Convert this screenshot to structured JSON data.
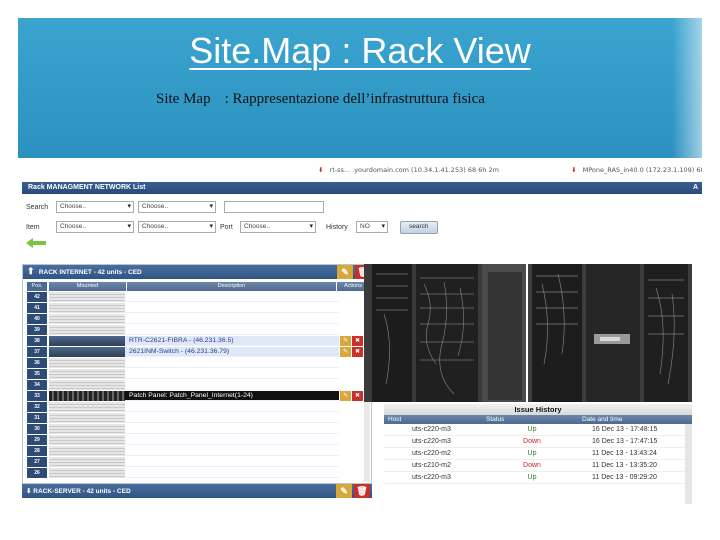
{
  "slide": {
    "title": "Site.Map : Rack View",
    "subtitle_left": "Site Map",
    "subtitle_right": ": Rappresentazione dell’infrastruttura fisica",
    "accent_color": "#3aa4cf"
  },
  "app": {
    "top_links": [
      "rt-ss... .yourdomain.com (10.34.1.41.253) 68 6h 2m",
      "MPone_RAS_in40.0 (172.23.1.109) 68 6h 2m"
    ],
    "list_title": "Rack MANAGMENT NETWORK List",
    "list_title_right": "A",
    "filters": {
      "search_label": "Search",
      "item_label": "Item",
      "port_label": "Port",
      "history_label": "History",
      "choose": "Choose..",
      "history_value": "NO",
      "search_button": "search"
    },
    "rack1": {
      "title": "RACK INTERNET - 42 units - CED",
      "col_pos": "Pos.",
      "col_mounted": "Mounted",
      "col_description": "Description",
      "col_actions": "Actions",
      "rows": [
        {
          "u": "42",
          "desc": ""
        },
        {
          "u": "41",
          "desc": ""
        },
        {
          "u": "40",
          "desc": ""
        },
        {
          "u": "39",
          "desc": ""
        },
        {
          "u": "38",
          "desc": "RTR-C2621-FIBRA - (46.231.36.5)"
        },
        {
          "u": "37",
          "desc": "2621INM-Switch - (46.231.36.79)"
        },
        {
          "u": "36",
          "desc": ""
        },
        {
          "u": "35",
          "desc": ""
        },
        {
          "u": "34",
          "desc": ""
        },
        {
          "u": "33",
          "desc": "Patch Panel: Patch_Panel_Internet(1-24)"
        },
        {
          "u": "32",
          "desc": ""
        },
        {
          "u": "31",
          "desc": ""
        },
        {
          "u": "30",
          "desc": ""
        },
        {
          "u": "29",
          "desc": ""
        },
        {
          "u": "28",
          "desc": ""
        },
        {
          "u": "27",
          "desc": ""
        },
        {
          "u": "26",
          "desc": ""
        }
      ]
    },
    "rack2": {
      "title": "RACK-SERVER - 42 units - CED"
    },
    "issue_history": {
      "title": "Issue History",
      "col_host": "Host",
      "col_status": "Status",
      "col_date": "Date and time",
      "rows": [
        {
          "host": "uts-c220-m3",
          "status": "Up",
          "date": "16 Dec 13 - 17:48:15"
        },
        {
          "host": "uts-c220-m3",
          "status": "Down",
          "date": "16 Dec 13 - 17:47:15"
        },
        {
          "host": "uts-c220-m2",
          "status": "Up",
          "date": "11 Dec 13 - 13:43:24"
        },
        {
          "host": "uts-c210-m2",
          "status": "Down",
          "date": "11 Dec 13 - 13:35:20"
        },
        {
          "host": "uts-c220-m3",
          "status": "Up",
          "date": "11 Dec 13 - 09:29:20"
        }
      ]
    }
  }
}
